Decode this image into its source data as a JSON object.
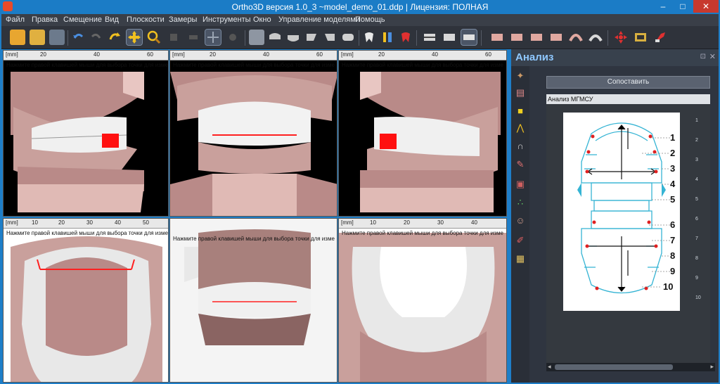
{
  "window": {
    "title": "Ortho3D версия 1.0_3  ~model_demo_01.ddp | Лицензия: ПОЛНАЯ",
    "min": "–",
    "max": "□",
    "close": "✕"
  },
  "menu": [
    "Файл",
    "Правка",
    "Смещение",
    "Вид",
    "Плоскости",
    "Замеры",
    "Инструменты",
    "Окно",
    "Управление моделями",
    "Помощь"
  ],
  "viewports": {
    "hint": "Нажмите правой клавишей мыши для выбора точки для изме",
    "unit": "[mm]",
    "ruler_top": [
      "20",
      "40",
      "60"
    ],
    "ruler_bottom_left": [
      "10",
      "20",
      "30",
      "40",
      "50"
    ],
    "ruler_bottom_right": [
      "10",
      "20",
      "30",
      "40"
    ]
  },
  "panel": {
    "title": "Анализ",
    "compare_button": "Сопоставить",
    "analysis_title": "Анализ МГМСУ",
    "row_numbers": [
      "1",
      "2",
      "3",
      "4",
      "5",
      "6",
      "7",
      "8",
      "9",
      "10"
    ],
    "diagram_labels": [
      "1",
      "2",
      "3",
      "4",
      "5",
      "6",
      "7",
      "8",
      "9",
      "10"
    ]
  },
  "colors": {
    "accent": "#1b7cc6",
    "gum": "#b98a88",
    "measure_line": "#ff2020",
    "diagram_line": "#35b4d4"
  }
}
